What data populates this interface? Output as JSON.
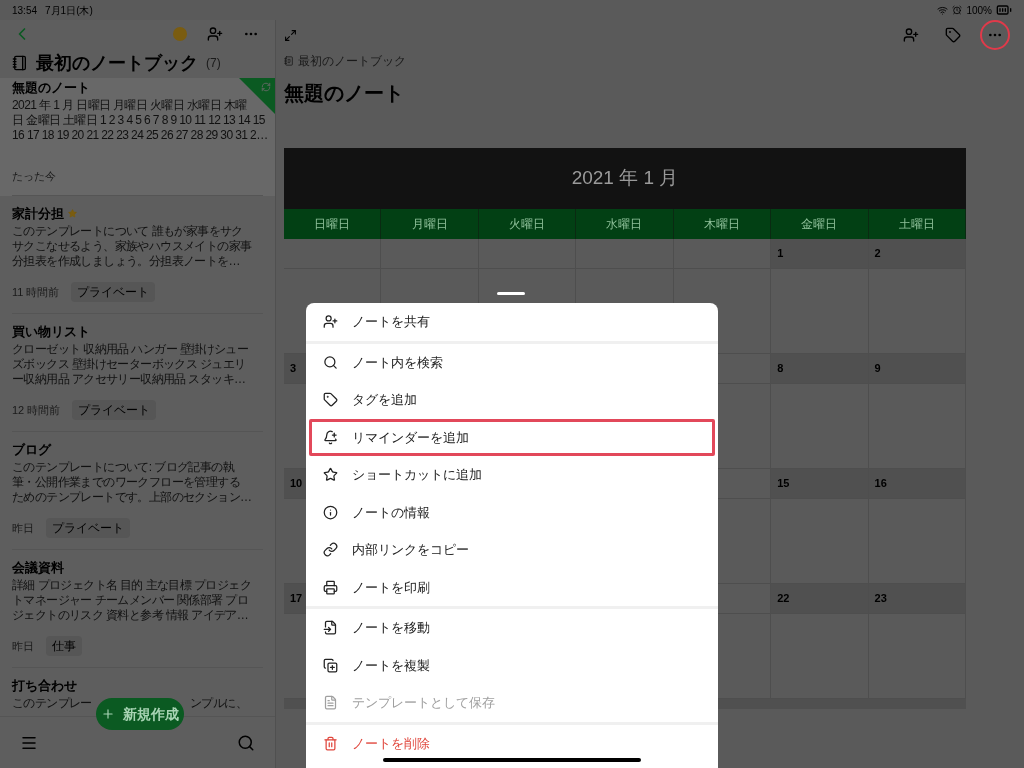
{
  "status_bar": {
    "time": "13:54",
    "date": "7月1日(木)",
    "battery": "100%"
  },
  "sidebar": {
    "notebook": {
      "title": "最初のノートブック",
      "count": "(7)"
    },
    "notes": [
      {
        "title": "無題のノート",
        "snippet_lines": [
          "2021 年 1 月 日曜日 月曜日 火曜日 水曜日 木曜",
          "日 金曜日 土曜日 1 2 3 4 5 6 7 8 9 10 11 12 13 14 15",
          "16 17 18 19 20 21 22 23 24 25 26 27 28 29 30 31 2…"
        ],
        "time": "たった今",
        "selected": true,
        "starred": false
      },
      {
        "title": "家計分担",
        "snippet_lines": [
          "このテンプレートについて 誰もが家事をサク",
          "サクこなせるよう、家族やハウスメイトの家事",
          "分担表を作成しましょう。分担表ノートを…"
        ],
        "time": "11 時間前",
        "tag": "プライベート",
        "selected": false,
        "starred": true
      },
      {
        "title": "買い物リスト",
        "snippet_lines": [
          "クローゼット 収納用品 ハンガー 壁掛けシュー",
          "ズボックス 壁掛けセーターボックス ジュエリ",
          "ー収納用品 アクセサリー収納用品 スタッキ…"
        ],
        "time": "12 時間前",
        "tag": "プライベート",
        "selected": false,
        "starred": false
      },
      {
        "title": "ブログ",
        "snippet_lines": [
          "このテンプレートについて: ブログ記事の執",
          "筆・公開作業までのワークフローを管理する",
          "ためのテンプレートです。上部のセクション…"
        ],
        "time": "昨日",
        "tag": "プライベート",
        "selected": false,
        "starred": false
      },
      {
        "title": "会議資料",
        "snippet_lines": [
          "詳細 プロジェクト名 目的 主な目標 プロジェク",
          "トマネージャー チームメンバー 関係部署 プロ",
          "ジェクトのリスク 資料と参考 情報 アイデア…"
        ],
        "time": "昨日",
        "tag": "仕事",
        "selected": false,
        "starred": false
      },
      {
        "title": "打ち合わせ",
        "snippet_parts": [
          "このテンプレー",
          "ンプルに、"
        ],
        "selected": false,
        "starred": false
      }
    ],
    "new_button": "新規作成"
  },
  "toolbar": [
    {
      "kind": "share",
      "highlighted": false
    },
    {
      "kind": "tag",
      "highlighted": false
    },
    {
      "kind": "more",
      "highlighted": true
    }
  ],
  "note": {
    "breadcrumb": "最初のノートブック",
    "title": "無題のノート",
    "calendar": {
      "title": "2021 年 1 月",
      "weekdays": [
        "日曜日",
        "月曜日",
        "火曜日",
        "水曜日",
        "木曜日",
        "金曜日",
        "土曜日"
      ],
      "weeks": [
        [
          {
            "kind": "blank"
          },
          {
            "kind": "blank"
          },
          {
            "kind": "blank"
          },
          {
            "kind": "blank"
          },
          {
            "kind": "blank"
          },
          {
            "kind": "date",
            "text": "1"
          },
          {
            "kind": "date",
            "text": "2"
          }
        ],
        [
          {
            "kind": "date",
            "text": "3"
          },
          {
            "kind": "covered"
          },
          {
            "kind": "covered"
          },
          {
            "kind": "covered"
          },
          {
            "kind": "blank"
          },
          {
            "kind": "date",
            "text": "8"
          },
          {
            "kind": "date",
            "text": "9"
          }
        ],
        [
          {
            "kind": "date",
            "text": "10"
          },
          {
            "kind": "covered"
          },
          {
            "kind": "covered"
          },
          {
            "kind": "covered"
          },
          {
            "kind": "blank"
          },
          {
            "kind": "date",
            "text": "15"
          },
          {
            "kind": "date",
            "text": "16"
          }
        ],
        [
          {
            "kind": "date",
            "text": "17"
          },
          {
            "kind": "covered"
          },
          {
            "kind": "covered"
          },
          {
            "kind": "covered"
          },
          {
            "kind": "blank"
          },
          {
            "kind": "date",
            "text": "22"
          },
          {
            "kind": "date",
            "text": "23"
          }
        ]
      ]
    }
  },
  "menu": {
    "sections": [
      [
        {
          "label": "ノートを共有",
          "kind": "normal",
          "disabled": false,
          "highlighted": false
        }
      ],
      [
        {
          "label": "ノート内を検索",
          "kind": "normal",
          "disabled": false,
          "highlighted": false
        },
        {
          "label": "タグを追加",
          "kind": "normal",
          "disabled": false,
          "highlighted": false
        },
        {
          "label": "リマインダーを追加",
          "kind": "normal",
          "disabled": false,
          "highlighted": true
        },
        {
          "label": "ショートカットに追加",
          "kind": "normal",
          "disabled": false,
          "highlighted": false
        },
        {
          "label": "ノートの情報",
          "kind": "normal",
          "disabled": false,
          "highlighted": false
        },
        {
          "label": "内部リンクをコピー",
          "kind": "normal",
          "disabled": false,
          "highlighted": false
        },
        {
          "label": "ノートを印刷",
          "kind": "normal",
          "disabled": false,
          "highlighted": false
        }
      ],
      [
        {
          "label": "ノートを移動",
          "kind": "normal",
          "disabled": false,
          "highlighted": false
        },
        {
          "label": "ノートを複製",
          "kind": "normal",
          "disabled": false,
          "highlighted": false
        },
        {
          "label": "テンプレートとして保存",
          "kind": "normal",
          "disabled": true,
          "highlighted": false
        }
      ],
      [
        {
          "label": "ノートを削除",
          "kind": "danger",
          "disabled": false,
          "highlighted": false
        }
      ]
    ]
  }
}
